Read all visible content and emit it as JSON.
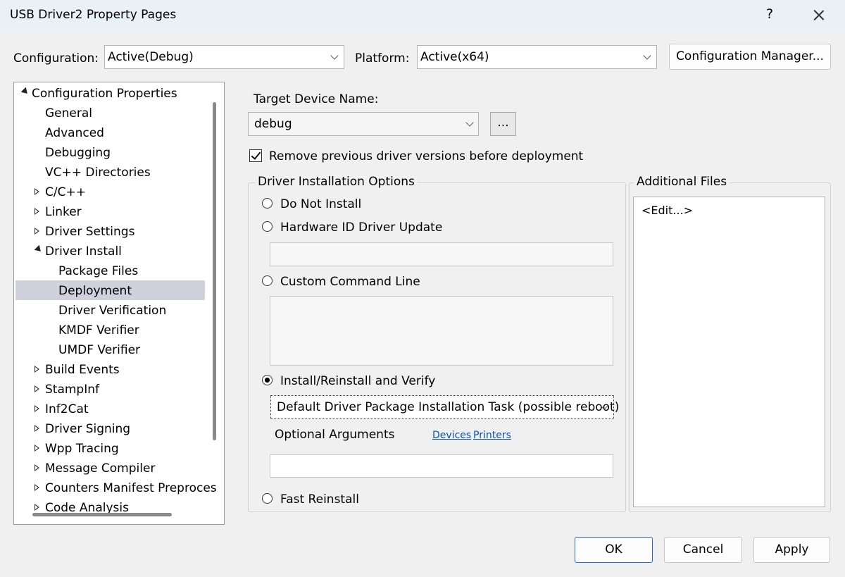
{
  "window": {
    "title": "USB Driver2 Property Pages",
    "help_glyph": "?"
  },
  "header": {
    "configuration_label": "Configuration:",
    "configuration_value": "Active(Debug)",
    "platform_label": "Platform:",
    "platform_value": "Active(x64)",
    "config_manager_label": "Configuration Manager..."
  },
  "tree": {
    "root": "Configuration Properties",
    "items": {
      "general": "General",
      "advanced": "Advanced",
      "debugging": "Debugging",
      "vcpp": "VC++ Directories",
      "cc": "C/C++",
      "linker": "Linker",
      "driver_settings": "Driver Settings",
      "driver_install": "Driver Install",
      "package_files": "Package Files",
      "deployment": "Deployment",
      "driver_verification": "Driver Verification",
      "kmdf_verifier": "KMDF Verifier",
      "umdf_verifier": "UMDF Verifier",
      "build_events": "Build Events",
      "stampinf": "StampInf",
      "inf2cat": "Inf2Cat",
      "driver_signing": "Driver Signing",
      "wpp_tracing": "Wpp Tracing",
      "message_compiler": "Message Compiler",
      "counters_manifest": "Counters Manifest Preproces",
      "code_analysis": "Code Analysis"
    }
  },
  "deployment": {
    "target_device_label": "Target Device Name:",
    "target_device_value": "debug",
    "browse_label": "...",
    "remove_previous_label": "Remove previous driver versions before deployment",
    "remove_previous_checked": true
  },
  "install_options": {
    "group_title": "Driver Installation Options",
    "do_not_install": "Do Not Install",
    "hardware_id": "Hardware ID Driver Update",
    "custom_command": "Custom Command Line",
    "install_reinstall": "Install/Reinstall and Verify",
    "task_value": "Default Driver Package Installation Task (possible reboot)",
    "optional_args_label": "Optional Arguments",
    "devices_link": "Devices",
    "printers_link": "Printers",
    "fast_reinstall": "Fast Reinstall",
    "selected": "install_reinstall"
  },
  "additional_files": {
    "title": "Additional Files",
    "edit_label": "<Edit...>"
  },
  "footer": {
    "ok": "OK",
    "cancel": "Cancel",
    "apply": "Apply"
  }
}
